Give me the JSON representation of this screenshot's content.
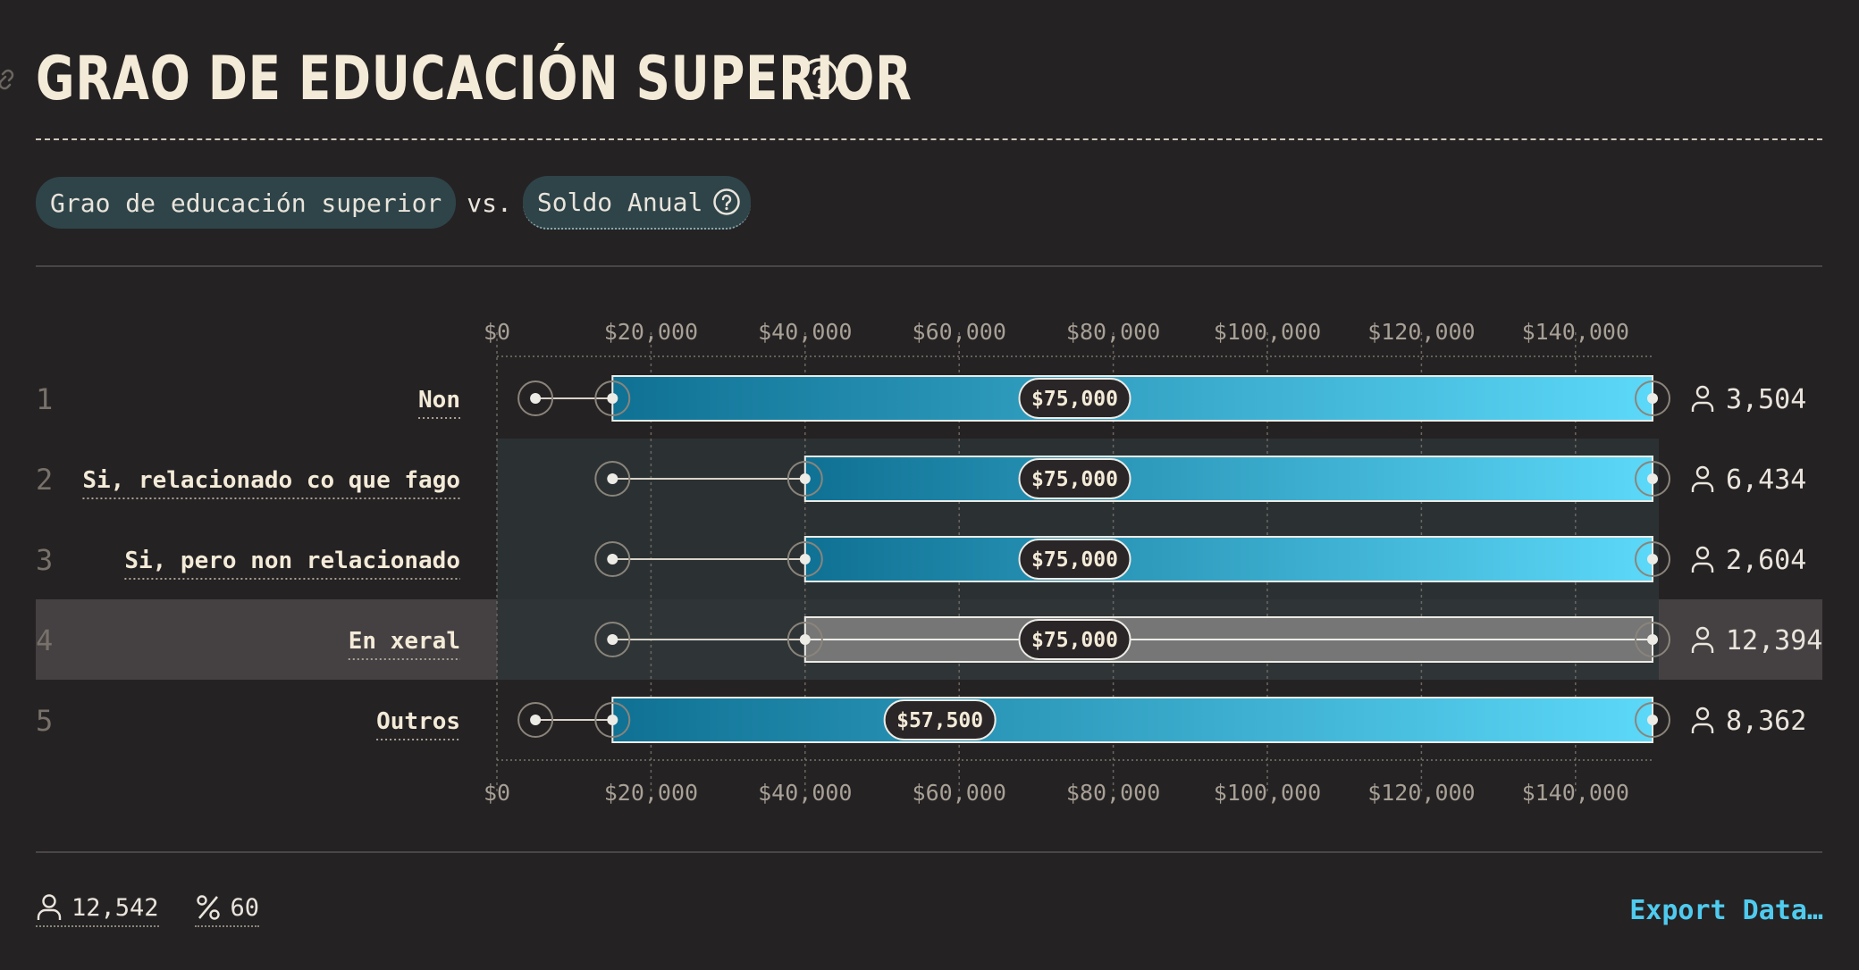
{
  "title": "GRAO DE EDUCACIÓN SUPERIOR",
  "compare": {
    "left": "Grao de educación superior",
    "vs": "vs.",
    "right": "Soldo Anual"
  },
  "footer": {
    "respondents": "12,542",
    "percent": "60",
    "export_label": "Export Data…"
  },
  "colors": {
    "background": "#252223",
    "bar_start": "#0f7194",
    "bar_end": "#5cd8f8",
    "highlight_bar": "#767676",
    "accent": "#4fcbef"
  },
  "chart_data": {
    "type": "bar",
    "x_axis": {
      "ticks": [
        "$0",
        "$20,000",
        "$40,000",
        "$60,000",
        "$80,000",
        "$100,000",
        "$120,000",
        "$140,000"
      ],
      "range": [
        0,
        150000
      ]
    },
    "rows": [
      {
        "rank": "1",
        "label": "Non",
        "min": 5000,
        "p25": 15000,
        "median": 75000,
        "median_label": "$75,000",
        "p75": 150000,
        "max": 150000,
        "count": "3,504",
        "highlight": false
      },
      {
        "rank": "2",
        "label": "Si, relacionado co que fago",
        "min": 15000,
        "p25": 40000,
        "median": 75000,
        "median_label": "$75,000",
        "p75": 150000,
        "max": 150000,
        "count": "6,434",
        "highlight": false
      },
      {
        "rank": "3",
        "label": "Si, pero non relacionado",
        "min": 15000,
        "p25": 40000,
        "median": 75000,
        "median_label": "$75,000",
        "p75": 150000,
        "max": 150000,
        "count": "2,604",
        "highlight": false
      },
      {
        "rank": "4",
        "label": "En xeral",
        "min": 15000,
        "p25": 40000,
        "median": 75000,
        "median_label": "$75,000",
        "p75": 150000,
        "max": 150000,
        "count": "12,394",
        "highlight": true
      },
      {
        "rank": "5",
        "label": "Outros",
        "min": 5000,
        "p25": 15000,
        "median": 57500,
        "median_label": "$57,500",
        "p75": 150000,
        "max": 150000,
        "count": "8,362",
        "highlight": false
      }
    ]
  }
}
